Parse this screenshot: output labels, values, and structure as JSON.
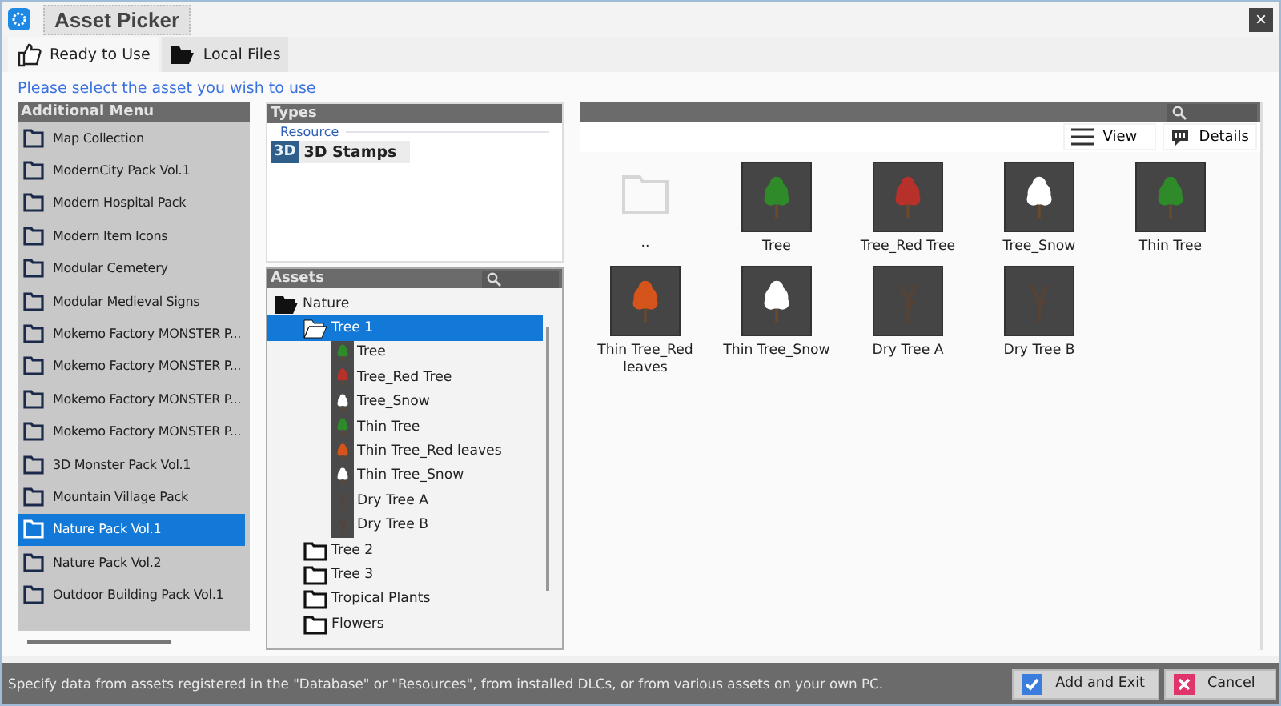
{
  "window": {
    "title": "Asset Picker",
    "close": "×"
  },
  "tabs": [
    {
      "label": "Ready to Use",
      "selected": true,
      "kind": "thumb"
    },
    {
      "label": "Local Files",
      "selected": false,
      "kind": "folder"
    }
  ],
  "prompt": "Please select the asset you wish to use",
  "additional_menu": {
    "title": "Additional Menu",
    "items": [
      {
        "label": "Map Collection",
        "selected": false
      },
      {
        "label": "ModernCity Pack Vol.1",
        "selected": false
      },
      {
        "label": "Modern Hospital Pack",
        "selected": false
      },
      {
        "label": "Modern Item Icons",
        "selected": false
      },
      {
        "label": "Modular Cemetery",
        "selected": false
      },
      {
        "label": "Modular Medieval Signs",
        "selected": false
      },
      {
        "label": "Mokemo Factory MONSTER P...",
        "selected": false
      },
      {
        "label": "Mokemo Factory MONSTER P...",
        "selected": false
      },
      {
        "label": "Mokemo Factory MONSTER P...",
        "selected": false
      },
      {
        "label": "Mokemo Factory MONSTER P...",
        "selected": false
      },
      {
        "label": "3D Monster Pack Vol.1",
        "selected": false
      },
      {
        "label": "Mountain Village Pack",
        "selected": false
      },
      {
        "label": "Nature Pack Vol.1",
        "selected": true
      },
      {
        "label": "Nature Pack Vol.2",
        "selected": false
      },
      {
        "label": "Outdoor Building Pack Vol.1",
        "selected": false
      }
    ]
  },
  "types": {
    "title": "Types",
    "group": "Resource",
    "items": [
      {
        "badge": "3D",
        "label": "3D Stamps",
        "selected": true
      }
    ]
  },
  "assets": {
    "title": "Assets",
    "tree": [
      {
        "label": "Nature",
        "kind": "folder",
        "expanded": true,
        "selected": false,
        "children": [
          {
            "label": "Tree 1",
            "kind": "folder",
            "expanded": true,
            "selected": true,
            "children": [
              {
                "label": "Tree",
                "kind": "tree",
                "color": "#2f8a2a",
                "selected": false
              },
              {
                "label": "Tree_Red Tree",
                "kind": "tree",
                "color": "#b8302a",
                "selected": false
              },
              {
                "label": "Tree_Snow",
                "kind": "tree",
                "color": "#ffffff",
                "selected": false
              },
              {
                "label": "Thin Tree",
                "kind": "tree",
                "color": "#2f8a2a",
                "selected": false
              },
              {
                "label": "Thin Tree_Red leaves",
                "kind": "tree",
                "color": "#d4541c",
                "selected": false
              },
              {
                "label": "Thin Tree_Snow",
                "kind": "tree",
                "color": "#ffffff",
                "selected": false
              },
              {
                "label": "Dry Tree A",
                "kind": "dry",
                "color": "#5a4232",
                "selected": false
              },
              {
                "label": "Dry Tree B",
                "kind": "dry",
                "color": "#5a4232",
                "selected": false
              }
            ]
          },
          {
            "label": "Tree 2",
            "kind": "folder",
            "expanded": false,
            "selected": false
          },
          {
            "label": "Tree 3",
            "kind": "folder",
            "expanded": false,
            "selected": false
          },
          {
            "label": "Tropical Plants",
            "kind": "folder",
            "expanded": false,
            "selected": false
          },
          {
            "label": "Flowers",
            "kind": "folder",
            "expanded": false,
            "selected": false
          }
        ]
      }
    ]
  },
  "browser": {
    "view_button": "View",
    "details_button": "Details",
    "items": [
      {
        "label": "..",
        "kind": "parent"
      },
      {
        "label": "Tree",
        "kind": "tree",
        "color": "#2f8a2a"
      },
      {
        "label": "Tree_Red Tree",
        "kind": "tree",
        "color": "#b8302a"
      },
      {
        "label": "Tree_Snow",
        "kind": "tree",
        "color": "#ffffff"
      },
      {
        "label": "Thin Tree",
        "kind": "tree",
        "color": "#2f8a2a"
      },
      {
        "label": "Thin Tree_Red leaves",
        "kind": "tree",
        "color": "#d4541c"
      },
      {
        "label": "Thin Tree_Snow",
        "kind": "tree",
        "color": "#ffffff"
      },
      {
        "label": "Dry Tree A",
        "kind": "dry",
        "color": "#5a4232"
      },
      {
        "label": "Dry Tree B",
        "kind": "dry",
        "color": "#5a4232"
      }
    ]
  },
  "status_bar": {
    "text": "Specify data from assets registered in the \"Database\" or \"Resources\", from installed DLCs, or from various assets on your own PC.",
    "buttons": [
      {
        "label": "Add and Exit",
        "kind": "ok"
      },
      {
        "label": "Cancel",
        "kind": "cancel"
      }
    ]
  }
}
